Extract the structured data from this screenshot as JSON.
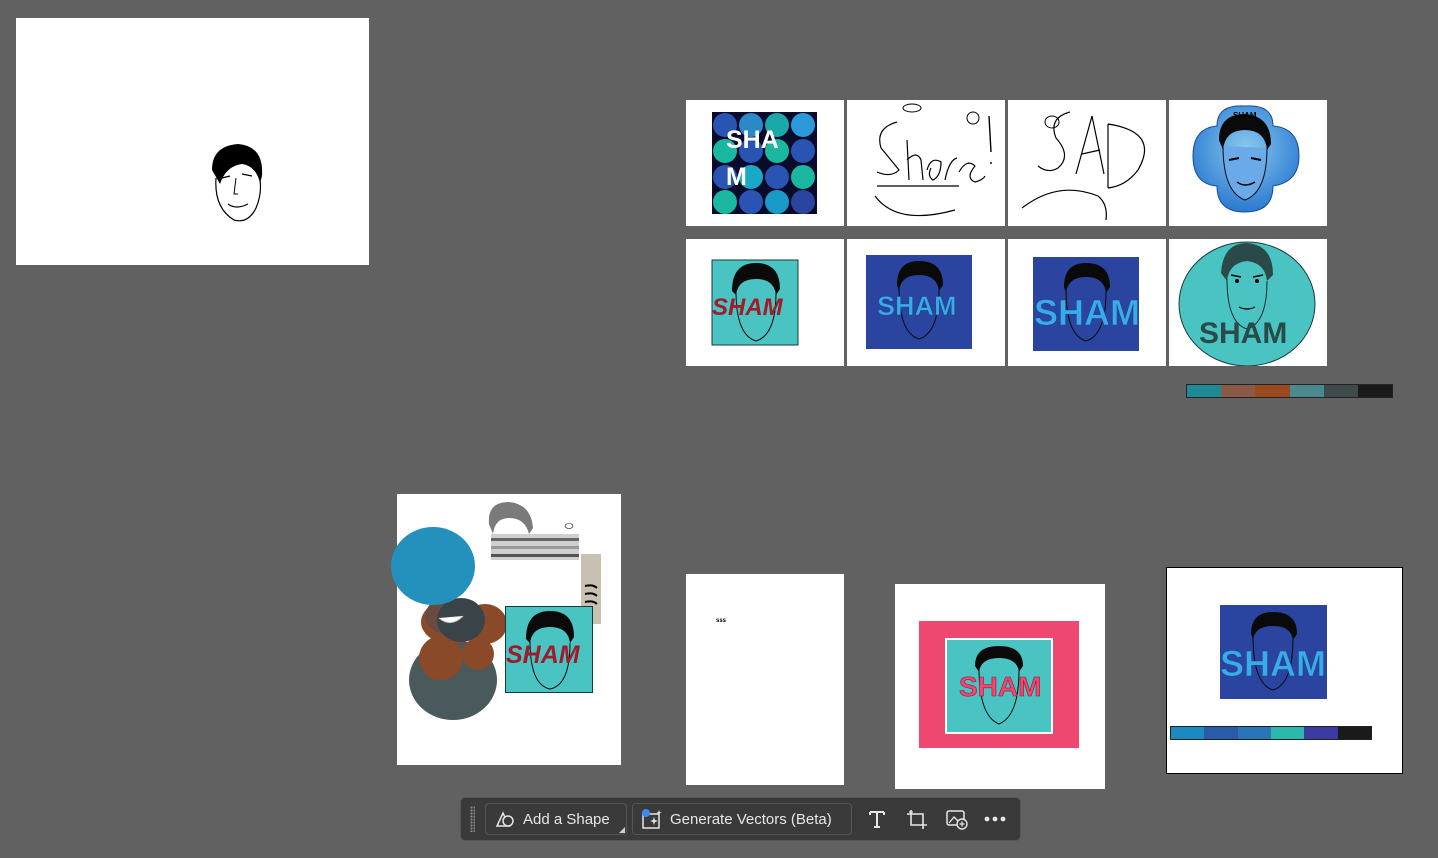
{
  "canvas": {
    "background": "#616161"
  },
  "artboard_texts": {
    "sham_tile_line1": "SHA",
    "sham_tile_line2": "M",
    "sham_word": "SHAM",
    "sham_small": "SHAM",
    "sss_label": "sss"
  },
  "sketches": {
    "share": "Share!",
    "sad": "SAD"
  },
  "palettes": {
    "top_right": [
      "#1e8a96",
      "#8a5a48",
      "#9a4a1e",
      "#4a8a8c",
      "#3e4a4c",
      "#1a1a1a"
    ],
    "bottom_right": [
      "#1a8ac0",
      "#2a5aaa",
      "#2a74b8",
      "#2ab8aa",
      "#3a3aa0",
      "#1a1a1a"
    ]
  },
  "colors": {
    "teal": "#4ac4c2",
    "royal_blue": "#2a44a0",
    "cyan_text": "#3aaae8",
    "maroon_text": "#a01c2c",
    "pink": "#ee4870",
    "dark_teal_text": "#2a4a4a"
  },
  "toolbar": {
    "add_shape_label": "Add a Shape",
    "add_shape_icon": "shape-icon",
    "generate_vectors_label": "Generate Vectors (Beta)",
    "generate_vectors_icon": "generate-vector-icon",
    "text_tool_icon": "text-icon",
    "crop_tool_icon": "crop-icon",
    "image_tool_icon": "image-add-icon",
    "more_icon": "more-icon"
  }
}
